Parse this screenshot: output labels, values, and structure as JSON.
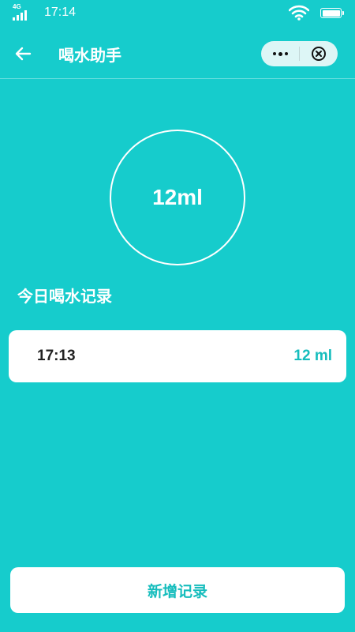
{
  "status_bar": {
    "network": "4G",
    "time": "17:14"
  },
  "nav": {
    "title": "喝水助手"
  },
  "summary": {
    "amount": "12ml"
  },
  "records_section": {
    "title": "今日喝水记录",
    "records": [
      {
        "time": "17:13",
        "amount": "12 ml"
      }
    ]
  },
  "actions": {
    "add_label": "新增记录"
  },
  "colors": {
    "background": "#16CCCC",
    "accent": "#16BDBD",
    "card": "#FFFFFF"
  }
}
